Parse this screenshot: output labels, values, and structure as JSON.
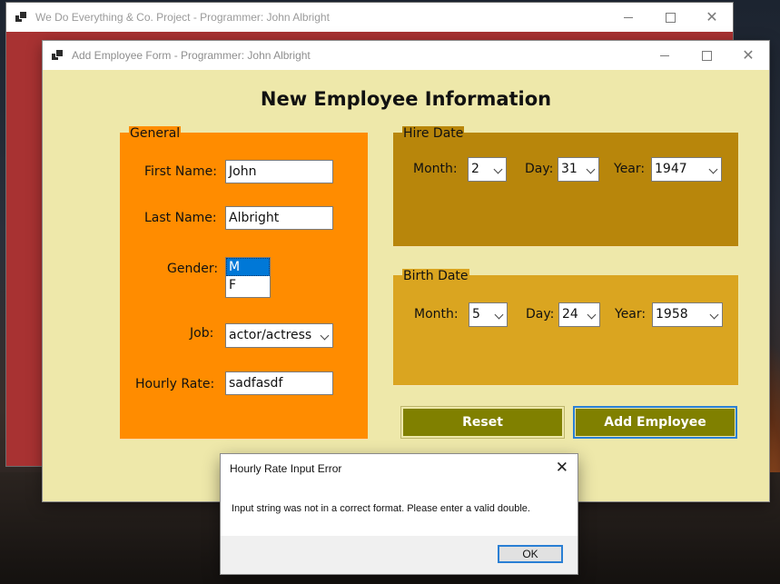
{
  "background_window": {
    "title": "We Do Everything & Co. Project - Programmer: John Albright",
    "color": "#a83232"
  },
  "main_window": {
    "title": "Add Employee Form - Programmer: John Albright",
    "heading": "New Employee Information",
    "background": "#eee8aa"
  },
  "general": {
    "legend": "General",
    "color": "#ff8c00",
    "first_name_label": "First Name:",
    "first_name_value": "John",
    "last_name_label": "Last Name:",
    "last_name_value": "Albright",
    "gender_label": "Gender:",
    "gender_options": [
      "M",
      "F"
    ],
    "gender_selected": "M",
    "job_label": "Job:",
    "job_value": "actor/actress",
    "rate_label": "Hourly Rate:",
    "rate_value": "sadfasdf"
  },
  "hire_date": {
    "legend": "Hire Date",
    "color": "#b8860b",
    "month_label": "Month:",
    "month_value": "2",
    "day_label": "Day:",
    "day_value": "31",
    "year_label": "Year:",
    "year_value": "1947"
  },
  "birth_date": {
    "legend": "Birth Date",
    "color": "#daa520",
    "month_label": "Month:",
    "month_value": "5",
    "day_label": "Day:",
    "day_value": "24",
    "year_label": "Year:",
    "year_value": "1958"
  },
  "buttons": {
    "reset": "Reset",
    "add": "Add Employee",
    "color": "#808000"
  },
  "dialog": {
    "title": "Hourly Rate Input Error",
    "message": "Input string was not in a correct format. Please enter a valid double.",
    "ok": "OK"
  },
  "icons": [
    "app-icon",
    "minimize-icon",
    "maximize-icon",
    "close-icon",
    "chevron-down-icon"
  ]
}
